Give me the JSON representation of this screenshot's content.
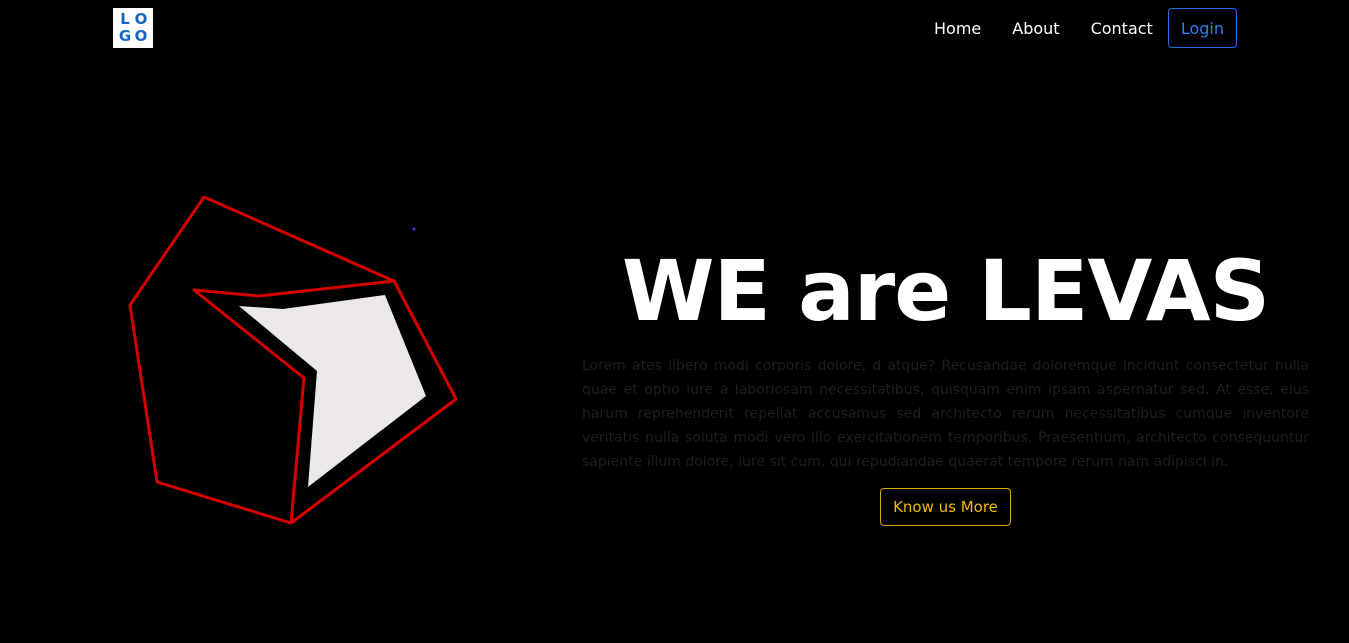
{
  "brand": {
    "logo_letters": [
      "L",
      "O",
      "G",
      "O"
    ],
    "logo_color": "#1565c0"
  },
  "nav": {
    "items": [
      {
        "label": "Home"
      },
      {
        "label": "About"
      },
      {
        "label": "Contact"
      }
    ],
    "login_label": "Login",
    "login_color": "#2f7df0"
  },
  "hero": {
    "title": "WE are LEVAS",
    "body": "Lorem ates libero modi corporis dolore, d atque? Recusandae doloremque incidunt consectetur nulla quae et optio iure a laboriosam necessitatibus, quisquam enim ipsam aspernatur sed. At esse, eius harum reprehenderit repellat accusamus sed architecto rerum necessitatibus cumque inventore veritatis nulla soluta modi vero illo exercitationem temporibus. Praesentium, architecto consequuntur sapiente illum dolore, iure sit cum, qui repudiandae quaerat tempore rerum nam adipisci in.",
    "cta_label": "Know us More",
    "cta_color": "#f0b90b"
  },
  "illustration": {
    "icon": "abstract-polygon-graphic",
    "outline_color": "#d40000",
    "fill_color": "#ede8e8"
  }
}
